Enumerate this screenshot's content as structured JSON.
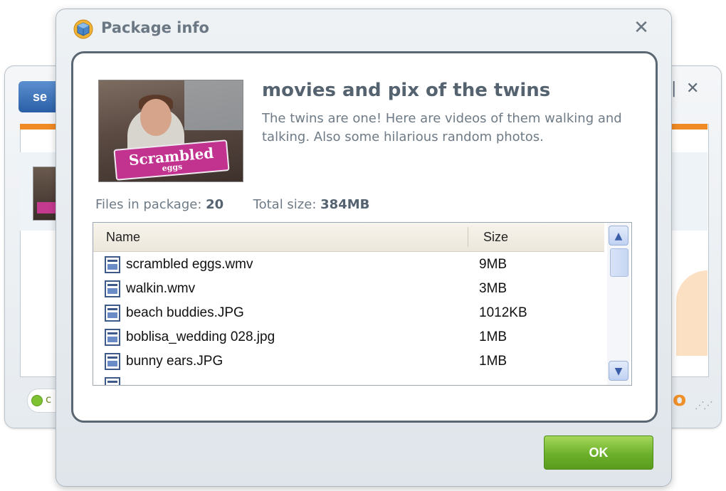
{
  "background_window": {
    "tab_label": "se",
    "status_text": "c",
    "brand_partial": "o"
  },
  "dialog": {
    "title": "Package info",
    "close_glyph": "✕",
    "package": {
      "title": "movies and pix of the twins",
      "description": "The twins are one! Here are videos of them walking and talking. Also some hilarious random photos.",
      "thumbnail_caption": "Scrambled",
      "thumbnail_subcaption": "eggs"
    },
    "stats": {
      "files_label": "Files in package:",
      "files_value": "20",
      "size_label": "Total size:",
      "size_value": "384MB"
    },
    "file_list": {
      "columns": {
        "name": "Name",
        "size": "Size"
      },
      "rows": [
        {
          "name": "scrambled eggs.wmv",
          "size": "9MB"
        },
        {
          "name": "walkin.wmv",
          "size": "3MB"
        },
        {
          "name": "beach buddies.JPG",
          "size": "1012KB"
        },
        {
          "name": "boblisa_wedding 028.jpg",
          "size": "1MB"
        },
        {
          "name": "bunny ears.JPG",
          "size": "1MB"
        }
      ]
    },
    "ok_label": "OK"
  },
  "icons": {
    "app": "package-icon",
    "file": "media-file-icon",
    "close": "close-icon",
    "scroll_up": "chevron-up-icon",
    "scroll_down": "chevron-down-icon"
  },
  "colors": {
    "ok_button": "#6cb02a",
    "panel_border": "#5a6672",
    "thumbnail_label": "#c2328f",
    "accent_orange": "#f08a24"
  }
}
